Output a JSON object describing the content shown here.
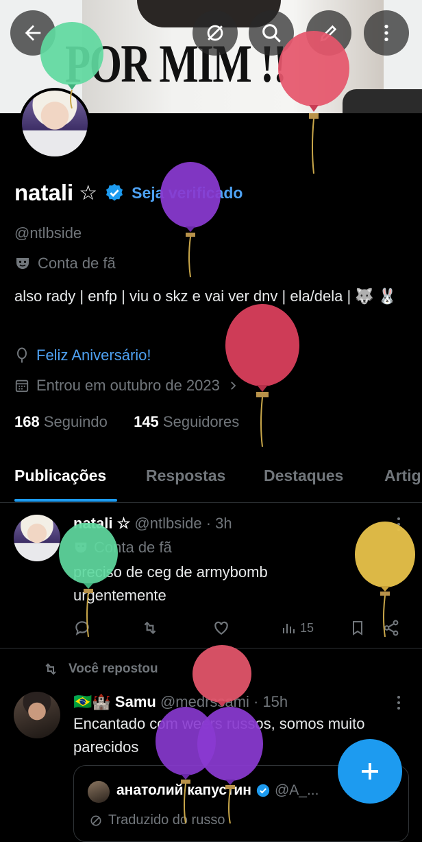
{
  "banner": {
    "text": "POR MIM !!"
  },
  "profile": {
    "name": "natali",
    "name_star": "☆",
    "get_verified": "Seja verificado",
    "handle": "@ntlbside",
    "label": "Conta de fã",
    "bio": "also rady | enfp | viu o skz e vai ver dnv | ela/dela | 🐺 🐰",
    "birthday": "Feliz Aniversário!",
    "joined": "Entrou em outubro de 2023",
    "following_count": "168",
    "following_label": "Seguindo",
    "followers_count": "145",
    "followers_label": "Seguidores"
  },
  "tabs": [
    "Publicações",
    "Respostas",
    "Destaques",
    "Artig"
  ],
  "posts": [
    {
      "name": "natali ☆",
      "handle": "@ntlbside · 3h",
      "label": "Conta de fã",
      "text": "preciso de ceg de armybomb urgentemente",
      "views": "15"
    },
    {
      "repost_label": "Você repostou",
      "flags": "🇧🇷🏰",
      "name": "Samu",
      "handle": "@medrssami · 15h",
      "text": "Encantado com weers russos, somos muito parecidos",
      "quote_name": "анатолий капустин",
      "quote_handle": "@A_...",
      "quote_sub": "Traduzido do russo"
    }
  ],
  "colors": {
    "accent": "#1d9bf0",
    "link": "#4ea1f2",
    "muted": "#71767b"
  }
}
